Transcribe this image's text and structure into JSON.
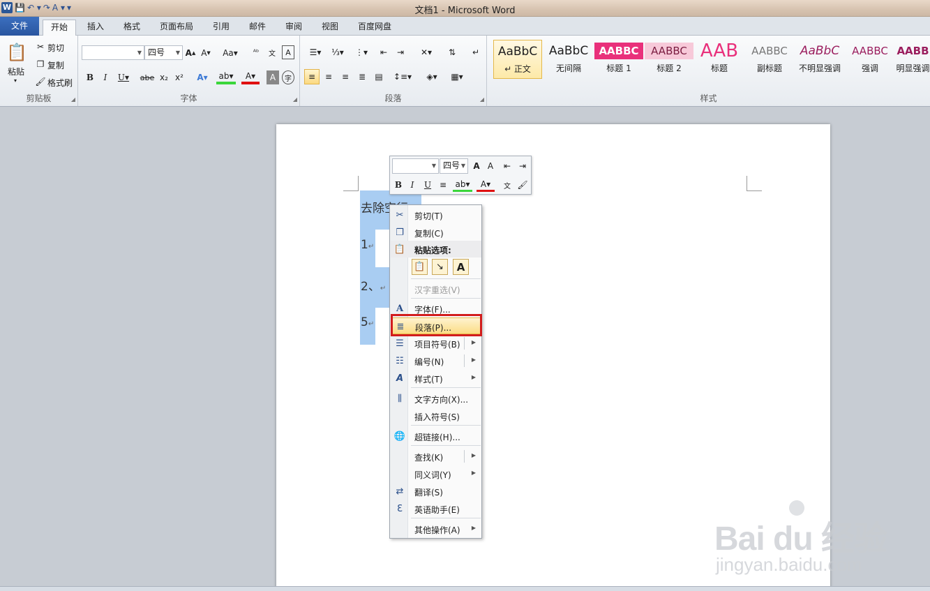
{
  "window": {
    "title": "文档1 - Microsoft Word"
  },
  "tabs": [
    {
      "label": "文件"
    },
    {
      "label": "开始"
    },
    {
      "label": "插入"
    },
    {
      "label": "格式"
    },
    {
      "label": "页面布局"
    },
    {
      "label": "引用"
    },
    {
      "label": "邮件"
    },
    {
      "label": "审阅"
    },
    {
      "label": "视图"
    },
    {
      "label": "百度网盘"
    }
  ],
  "ribbon": {
    "clipboard": {
      "paste": "粘贴",
      "cut": "剪切",
      "copy": "复制",
      "format_painter": "格式刷",
      "group_label": "剪贴板"
    },
    "font": {
      "font_name": "",
      "font_size": "四号",
      "group_label": "字体"
    },
    "paragraph": {
      "group_label": "段落"
    },
    "styles": {
      "group_label": "样式",
      "items": [
        {
          "preview": "AaBbC",
          "label": "↵ 正文"
        },
        {
          "preview": "AaBbC",
          "label": "无间隔"
        },
        {
          "preview": "AABBC",
          "label": "标题 1"
        },
        {
          "preview": "AABBC",
          "label": "标题 2"
        },
        {
          "preview": "AAB",
          "label": "标题"
        },
        {
          "preview": "AABBC",
          "label": "副标题"
        },
        {
          "preview": "AaBbC",
          "label": "不明显强调"
        },
        {
          "preview": "AABBC",
          "label": "强调"
        },
        {
          "preview": "AABB",
          "label": "明显强调"
        }
      ]
    }
  },
  "mini_toolbar": {
    "font_name": "",
    "font_size": "四号"
  },
  "document": {
    "lines": [
      {
        "text": "去除空行"
      },
      {
        "text": "1"
      },
      {
        "text": "2、"
      },
      {
        "text": "5"
      }
    ]
  },
  "context_menu": {
    "items": [
      {
        "label": "剪切(T)",
        "icon": "scissors-icon"
      },
      {
        "label": "复制(C)",
        "icon": "copy-icon"
      },
      {
        "label": "粘贴选项:",
        "icon": "paste-icon"
      },
      {
        "label": "汉字重选(V)"
      },
      {
        "label": "字体(F)...",
        "icon": "font-icon"
      },
      {
        "label": "段落(P)...",
        "icon": "paragraph-icon"
      },
      {
        "label": "项目符号(B)",
        "icon": "bullets-icon"
      },
      {
        "label": "编号(N)",
        "icon": "numbering-icon"
      },
      {
        "label": "样式(T)",
        "icon": "styles-icon"
      },
      {
        "label": "文字方向(X)...",
        "icon": "text-direction-icon"
      },
      {
        "label": "插入符号(S)"
      },
      {
        "label": "超链接(H)...",
        "icon": "hyperlink-icon"
      },
      {
        "label": "查找(K)"
      },
      {
        "label": "同义词(Y)"
      },
      {
        "label": "翻译(S)",
        "icon": "translate-icon"
      },
      {
        "label": "英语助手(E)",
        "icon": "english-assistant-icon"
      },
      {
        "label": "其他操作(A)"
      }
    ]
  },
  "watermark": {
    "main": "Bai du 经验",
    "sub": "jingyan.baidu.com"
  },
  "colors": {
    "highlight_border": "#d21d1d",
    "selection": "#a9cdf2",
    "file_tab": "#2a56a0"
  }
}
